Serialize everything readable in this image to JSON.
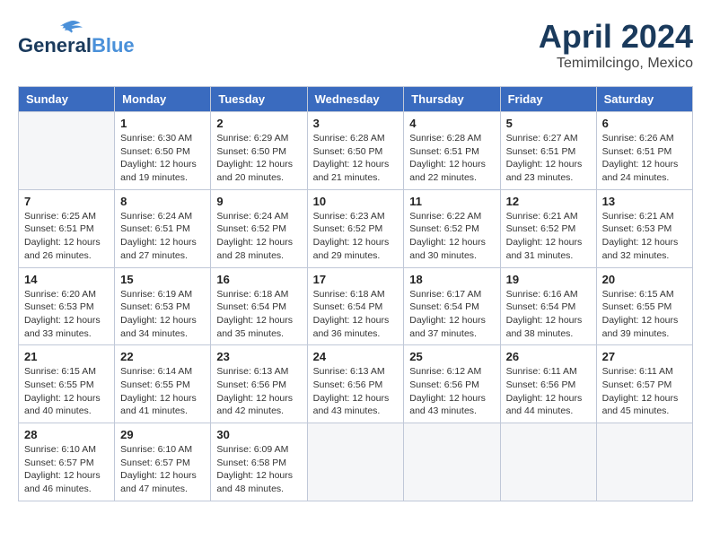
{
  "header": {
    "logo_line1": "General",
    "logo_line2": "Blue",
    "month_title": "April 2024",
    "location": "Temimilcingo, Mexico"
  },
  "weekdays": [
    "Sunday",
    "Monday",
    "Tuesday",
    "Wednesday",
    "Thursday",
    "Friday",
    "Saturday"
  ],
  "weeks": [
    [
      {
        "day": "",
        "info": ""
      },
      {
        "day": "1",
        "info": "Sunrise: 6:30 AM\nSunset: 6:50 PM\nDaylight: 12 hours\nand 19 minutes."
      },
      {
        "day": "2",
        "info": "Sunrise: 6:29 AM\nSunset: 6:50 PM\nDaylight: 12 hours\nand 20 minutes."
      },
      {
        "day": "3",
        "info": "Sunrise: 6:28 AM\nSunset: 6:50 PM\nDaylight: 12 hours\nand 21 minutes."
      },
      {
        "day": "4",
        "info": "Sunrise: 6:28 AM\nSunset: 6:51 PM\nDaylight: 12 hours\nand 22 minutes."
      },
      {
        "day": "5",
        "info": "Sunrise: 6:27 AM\nSunset: 6:51 PM\nDaylight: 12 hours\nand 23 minutes."
      },
      {
        "day": "6",
        "info": "Sunrise: 6:26 AM\nSunset: 6:51 PM\nDaylight: 12 hours\nand 24 minutes."
      }
    ],
    [
      {
        "day": "7",
        "info": "Sunrise: 6:25 AM\nSunset: 6:51 PM\nDaylight: 12 hours\nand 26 minutes."
      },
      {
        "day": "8",
        "info": "Sunrise: 6:24 AM\nSunset: 6:51 PM\nDaylight: 12 hours\nand 27 minutes."
      },
      {
        "day": "9",
        "info": "Sunrise: 6:24 AM\nSunset: 6:52 PM\nDaylight: 12 hours\nand 28 minutes."
      },
      {
        "day": "10",
        "info": "Sunrise: 6:23 AM\nSunset: 6:52 PM\nDaylight: 12 hours\nand 29 minutes."
      },
      {
        "day": "11",
        "info": "Sunrise: 6:22 AM\nSunset: 6:52 PM\nDaylight: 12 hours\nand 30 minutes."
      },
      {
        "day": "12",
        "info": "Sunrise: 6:21 AM\nSunset: 6:52 PM\nDaylight: 12 hours\nand 31 minutes."
      },
      {
        "day": "13",
        "info": "Sunrise: 6:21 AM\nSunset: 6:53 PM\nDaylight: 12 hours\nand 32 minutes."
      }
    ],
    [
      {
        "day": "14",
        "info": "Sunrise: 6:20 AM\nSunset: 6:53 PM\nDaylight: 12 hours\nand 33 minutes."
      },
      {
        "day": "15",
        "info": "Sunrise: 6:19 AM\nSunset: 6:53 PM\nDaylight: 12 hours\nand 34 minutes."
      },
      {
        "day": "16",
        "info": "Sunrise: 6:18 AM\nSunset: 6:54 PM\nDaylight: 12 hours\nand 35 minutes."
      },
      {
        "day": "17",
        "info": "Sunrise: 6:18 AM\nSunset: 6:54 PM\nDaylight: 12 hours\nand 36 minutes."
      },
      {
        "day": "18",
        "info": "Sunrise: 6:17 AM\nSunset: 6:54 PM\nDaylight: 12 hours\nand 37 minutes."
      },
      {
        "day": "19",
        "info": "Sunrise: 6:16 AM\nSunset: 6:54 PM\nDaylight: 12 hours\nand 38 minutes."
      },
      {
        "day": "20",
        "info": "Sunrise: 6:15 AM\nSunset: 6:55 PM\nDaylight: 12 hours\nand 39 minutes."
      }
    ],
    [
      {
        "day": "21",
        "info": "Sunrise: 6:15 AM\nSunset: 6:55 PM\nDaylight: 12 hours\nand 40 minutes."
      },
      {
        "day": "22",
        "info": "Sunrise: 6:14 AM\nSunset: 6:55 PM\nDaylight: 12 hours\nand 41 minutes."
      },
      {
        "day": "23",
        "info": "Sunrise: 6:13 AM\nSunset: 6:56 PM\nDaylight: 12 hours\nand 42 minutes."
      },
      {
        "day": "24",
        "info": "Sunrise: 6:13 AM\nSunset: 6:56 PM\nDaylight: 12 hours\nand 43 minutes."
      },
      {
        "day": "25",
        "info": "Sunrise: 6:12 AM\nSunset: 6:56 PM\nDaylight: 12 hours\nand 43 minutes."
      },
      {
        "day": "26",
        "info": "Sunrise: 6:11 AM\nSunset: 6:56 PM\nDaylight: 12 hours\nand 44 minutes."
      },
      {
        "day": "27",
        "info": "Sunrise: 6:11 AM\nSunset: 6:57 PM\nDaylight: 12 hours\nand 45 minutes."
      }
    ],
    [
      {
        "day": "28",
        "info": "Sunrise: 6:10 AM\nSunset: 6:57 PM\nDaylight: 12 hours\nand 46 minutes."
      },
      {
        "day": "29",
        "info": "Sunrise: 6:10 AM\nSunset: 6:57 PM\nDaylight: 12 hours\nand 47 minutes."
      },
      {
        "day": "30",
        "info": "Sunrise: 6:09 AM\nSunset: 6:58 PM\nDaylight: 12 hours\nand 48 minutes."
      },
      {
        "day": "",
        "info": ""
      },
      {
        "day": "",
        "info": ""
      },
      {
        "day": "",
        "info": ""
      },
      {
        "day": "",
        "info": ""
      }
    ]
  ]
}
